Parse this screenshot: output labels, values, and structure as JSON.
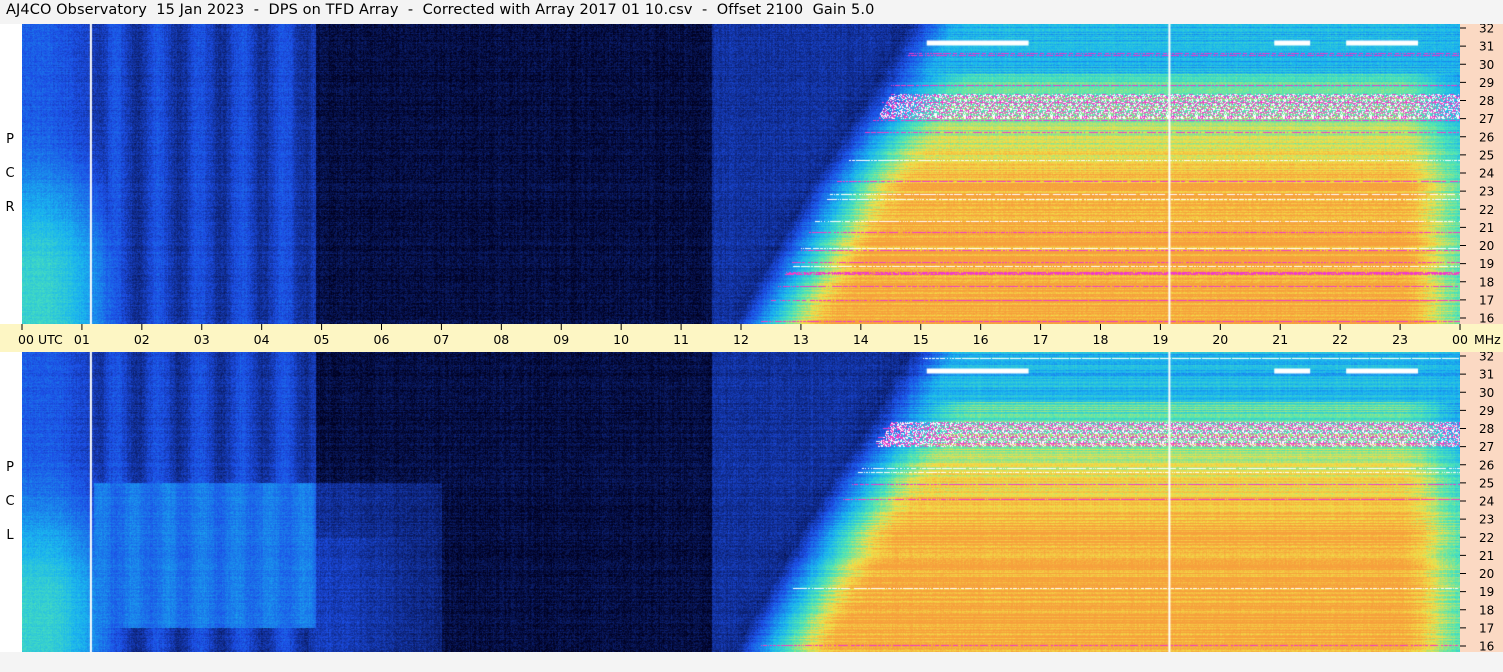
{
  "header": {
    "title": "AJ4CO Observatory  15 Jan 2023  -  DPS on TFD Array  -  Corrected with Array 2017 01 10.csv  -  Offset 2100  Gain 5.0"
  },
  "panels": {
    "top_label_letters": [
      "R",
      "C",
      "P"
    ],
    "bottom_label_letters": [
      "L",
      "C",
      "P"
    ]
  },
  "time_axis": {
    "ticks": [
      "00",
      "01",
      "02",
      "03",
      "04",
      "05",
      "06",
      "07",
      "08",
      "09",
      "10",
      "11",
      "12",
      "13",
      "14",
      "15",
      "16",
      "17",
      "18",
      "19",
      "20",
      "21",
      "22",
      "23",
      "00"
    ],
    "utc_label": "UTC",
    "mhz_label": "MHz"
  },
  "freq_axis": {
    "ticks": [
      "32",
      "31",
      "30",
      "29",
      "28",
      "27",
      "26",
      "25",
      "24",
      "23",
      "22",
      "21",
      "20",
      "19",
      "18",
      "17",
      "16"
    ]
  },
  "chart_data": {
    "type": "heatmap",
    "title": "AJ4CO Observatory  15 Jan 2023  -  DPS on TFD Array  -  Corrected with Array 2017 01 10.csv  -  Offset 2100  Gain 5.0",
    "x_unit": "UTC",
    "x_range": [
      0,
      24
    ],
    "y_unit": "MHz",
    "y_range": [
      16,
      32
    ],
    "panels": [
      "RCP",
      "LCP"
    ],
    "colors": {
      "night": "#00001e",
      "low": "#1c4ee6",
      "mid": "#19b4f0",
      "green": "#50e6b4",
      "yellow": "#f2e048",
      "orange": "#f7a03c",
      "magenta": "#f03cc8",
      "white": "#ffffff",
      "timing_line": "#ffffff"
    },
    "timing_marks_utc": [
      1.15,
      19.15
    ]
  }
}
